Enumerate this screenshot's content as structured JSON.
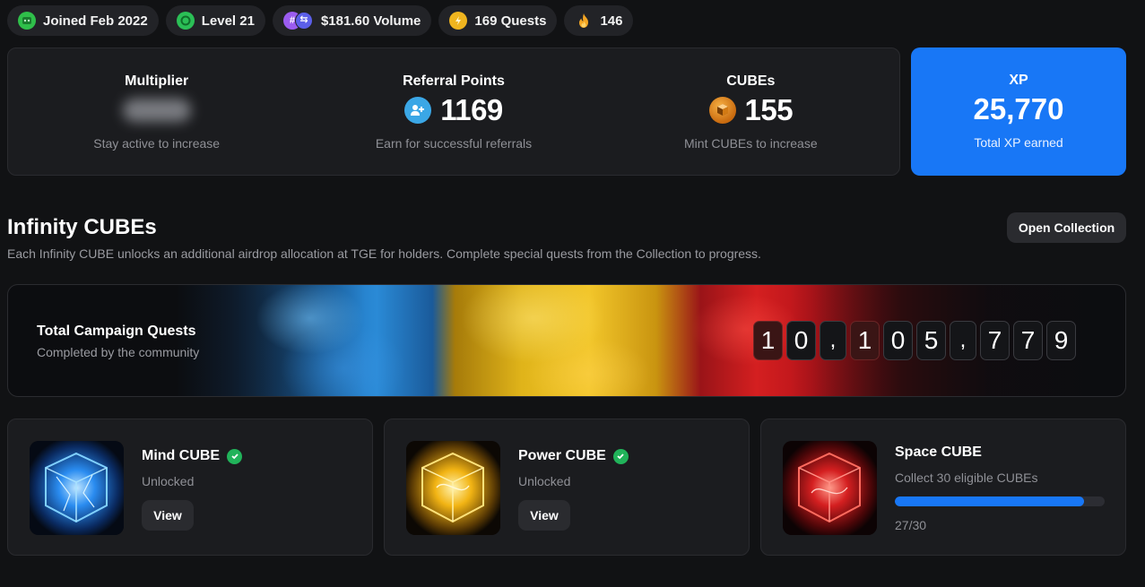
{
  "pills": [
    {
      "label": "Joined Feb 2022",
      "icon": "joined-icon"
    },
    {
      "label": "Level 21",
      "icon": "level-icon"
    },
    {
      "label": "$181.60 Volume",
      "icon": "volume-icon"
    },
    {
      "label": "169 Quests",
      "icon": "bolt-icon"
    },
    {
      "label": "146",
      "icon": "fire-icon"
    }
  ],
  "stats": {
    "multiplier": {
      "label": "Multiplier",
      "sub": "Stay active to increase"
    },
    "referral": {
      "label": "Referral Points",
      "value": "1169",
      "sub": "Earn for successful referrals"
    },
    "cubes": {
      "label": "CUBEs",
      "value": "155",
      "sub": "Mint CUBEs to increase"
    },
    "xp": {
      "label": "XP",
      "value": "25,770",
      "sub": "Total XP earned"
    }
  },
  "section": {
    "title": "Infinity CUBEs",
    "description": "Each Infinity CUBE unlocks an additional airdrop allocation at TGE for holders. Complete special quests from the Collection to progress.",
    "open_button": "Open Collection"
  },
  "campaign": {
    "title": "Total Campaign Quests",
    "subtitle": "Completed by the community",
    "digits": [
      "1",
      "0",
      ",",
      "1",
      "0",
      "5",
      ",",
      "7",
      "7",
      "9"
    ]
  },
  "cards": {
    "mind": {
      "title": "Mind CUBE",
      "status": "Unlocked",
      "button": "View"
    },
    "power": {
      "title": "Power CUBE",
      "status": "Unlocked",
      "button": "View"
    },
    "space": {
      "title": "Space CUBE",
      "status": "Collect 30 eligible CUBEs",
      "progress_text": "27/30",
      "progress": 0.9
    }
  },
  "colors": {
    "accent": "#1877f6",
    "success": "#21b35a",
    "background": "#111214",
    "panel": "#1b1c1f"
  }
}
